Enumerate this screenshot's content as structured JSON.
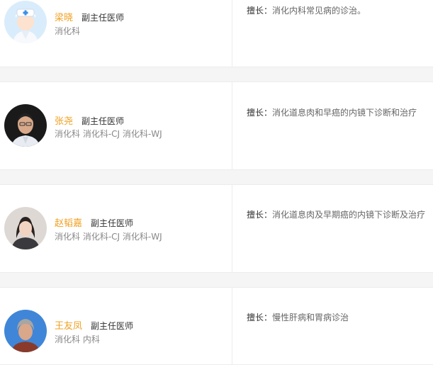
{
  "doctors": [
    {
      "avatar_icon": "nurse-cartoon-avatar-icon",
      "name": "梁晓",
      "title": "副主任医师",
      "departments": "消化科",
      "specialty_label": "擅长：",
      "specialty": "消化内科常见病的诊治。"
    },
    {
      "avatar_icon": "doctor-photo-avatar",
      "name": "张尧",
      "title": "副主任医师",
      "departments": "消化科 消化科-CJ 消化科-WJ",
      "specialty_label": "擅长：",
      "specialty": "消化道息肉和早癌的内镜下诊断和治疗"
    },
    {
      "avatar_icon": "doctor-photo-avatar",
      "name": "赵韬嘉",
      "title": "副主任医师",
      "departments": "消化科 消化科-CJ 消化科-WJ",
      "specialty_label": "擅长：",
      "specialty": "消化道息肉及早期癌的内镜下诊断及治疗"
    },
    {
      "avatar_icon": "doctor-photo-avatar",
      "name": "王友凤",
      "title": "副主任医师",
      "departments": "消化科 内科",
      "specialty_label": "擅长：",
      "specialty": "慢性肝病和胃病诊治"
    }
  ],
  "colors": {
    "name": "#f0a020",
    "background": "#f5f5f5",
    "card": "#ffffff"
  }
}
